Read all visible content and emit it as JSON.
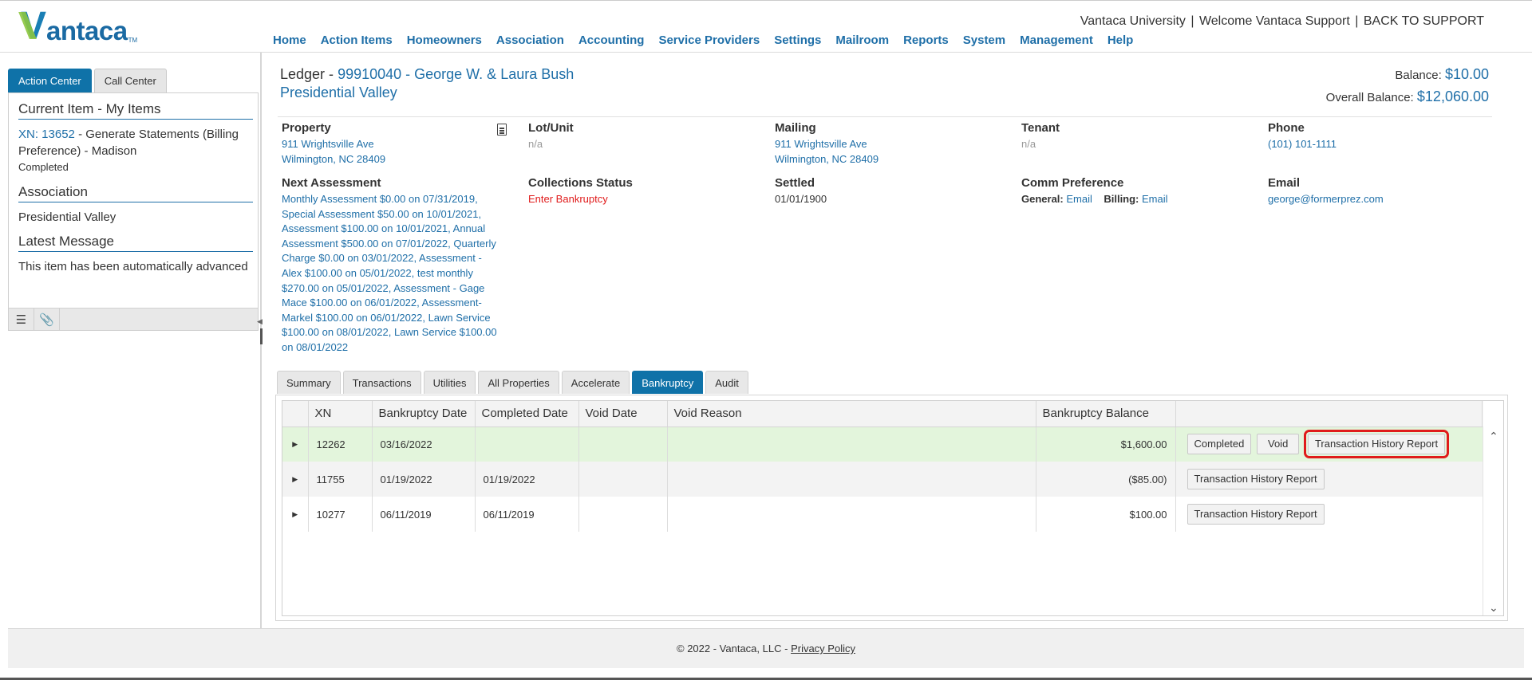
{
  "brand": {
    "logo_rest": "antaca",
    "logo_v": "V",
    "tm": "TM"
  },
  "header": {
    "university": "Vantaca University",
    "welcome": "Welcome Vantaca Support",
    "back": "BACK TO SUPPORT",
    "nav": [
      "Home",
      "Action Items",
      "Homeowners",
      "Association",
      "Accounting",
      "Service Providers",
      "Settings",
      "Mailroom",
      "Reports",
      "System",
      "Management",
      "Help"
    ]
  },
  "left_panel": {
    "tabs": [
      "Action Center",
      "Call Center"
    ],
    "current_heading": "Current Item - My Items",
    "xn_link": "XN: 13652",
    "xn_desc": "- Generate Statements (Billing Preference) - Madison",
    "status": "Completed",
    "assoc_heading": "Association",
    "assoc_link": "Presidential Valley",
    "msg_heading": "Latest Message",
    "msg_text": "This item has been automatically advanced"
  },
  "ledger": {
    "prefix": "Ledger -",
    "account": "99910040 - George W. & Laura Bush",
    "association": "Presidential Valley",
    "balance_label": "Balance:",
    "balance": "$10.00",
    "overall_label": "Overall Balance:",
    "overall": "$12,060.00"
  },
  "info": {
    "property_label": "Property",
    "property_line1": "911 Wrightsville Ave",
    "property_line2": "Wilmington, NC 28409",
    "lot_label": "Lot/Unit",
    "lot_val": "n/a",
    "mailing_label": "Mailing",
    "mailing_line1": "911 Wrightsville Ave",
    "mailing_line2": "Wilmington, NC 28409",
    "tenant_label": "Tenant",
    "tenant_val": "n/a",
    "phone_label": "Phone",
    "phone_val": "(101) 101-1111",
    "next_label": "Next Assessment",
    "next_val": "Monthly Assessment $0.00 on 07/31/2019, Special Assessment $50.00 on 10/01/2021, Assessment $100.00 on 10/01/2021, Annual Assessment $500.00 on 07/01/2022, Quarterly Charge $0.00 on 03/01/2022, Assessment - Alex $100.00 on 05/01/2022, test monthly $270.00 on 05/01/2022, Assessment - Gage Mace $100.00 on 06/01/2022, Assessment-Markel $100.00 on 06/01/2022, Lawn Service $100.00 on 08/01/2022, Lawn Service $100.00 on 08/01/2022",
    "collections_label": "Collections Status",
    "collections_val": "Enter Bankruptcy",
    "settled_label": "Settled",
    "settled_val": "01/01/1900",
    "comm_label": "Comm Preference",
    "comm_general_label": "General:",
    "comm_general_val": "Email",
    "comm_billing_label": "Billing:",
    "comm_billing_val": "Email",
    "email_label": "Email",
    "email_val": "george@formerprez.com"
  },
  "tabs": [
    "Summary",
    "Transactions",
    "Utilities",
    "All Properties",
    "Accelerate",
    "Bankruptcy",
    "Audit"
  ],
  "grid": {
    "columns": [
      "XN",
      "Bankruptcy Date",
      "Completed Date",
      "Void Date",
      "Void Reason",
      "Bankruptcy Balance"
    ],
    "rows": [
      {
        "xn": "12262",
        "bdate": "03/16/2022",
        "cdate": "",
        "vdate": "",
        "reason": "",
        "balance": "$1,600.00",
        "actions": [
          "Completed",
          "Void",
          "Transaction History Report"
        ]
      },
      {
        "xn": "11755",
        "bdate": "01/19/2022",
        "cdate": "01/19/2022",
        "vdate": "",
        "reason": "",
        "balance": "($85.00)",
        "actions": [
          "Transaction History Report"
        ]
      },
      {
        "xn": "10277",
        "bdate": "06/11/2019",
        "cdate": "06/11/2019",
        "vdate": "",
        "reason": "",
        "balance": "$100.00",
        "actions": [
          "Transaction History Report"
        ]
      }
    ]
  },
  "footer": {
    "copyright": "© 2022 - Vantaca, LLC -",
    "privacy": "Privacy Policy"
  },
  "colors": {
    "accent": "#1f6fa8",
    "active_tab": "#0f72a8",
    "highlight": "#e01b1b",
    "row_green": "#e3f5dc"
  }
}
